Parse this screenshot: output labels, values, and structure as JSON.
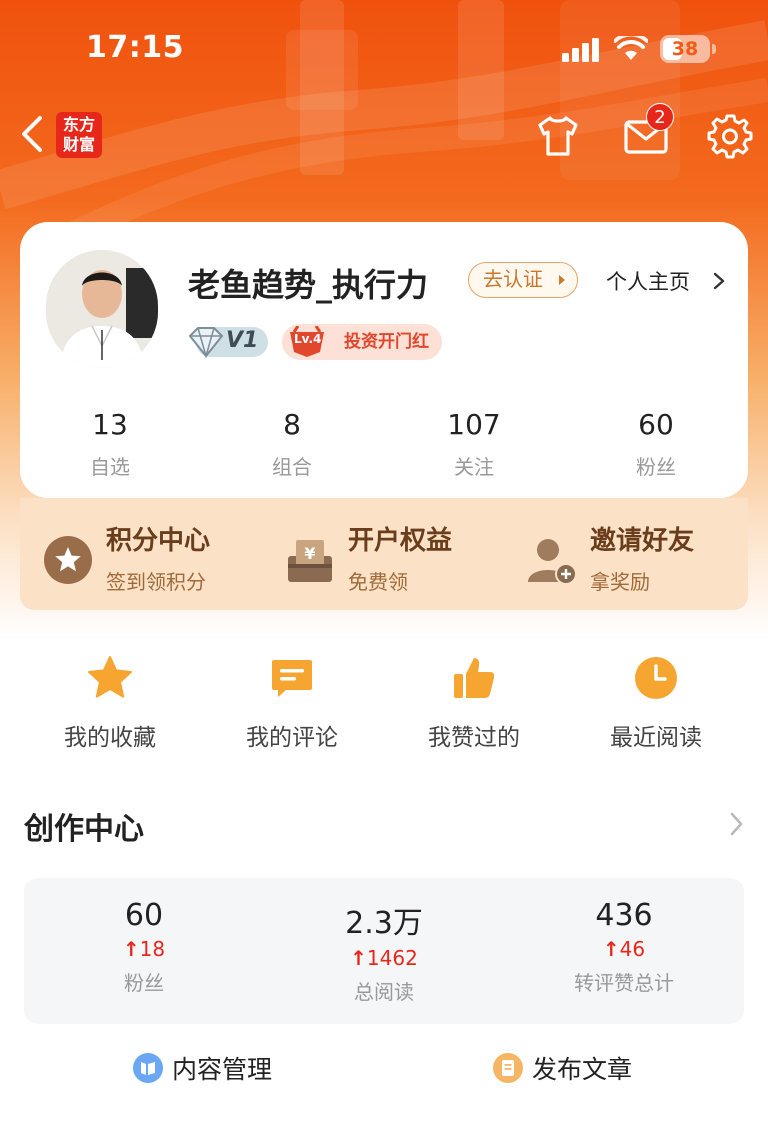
{
  "status_bar": {
    "time": "17:15",
    "battery_level": "38"
  },
  "header": {
    "logo_line1": "东方",
    "logo_line2": "财富",
    "mail_badge_count": "2",
    "icons": [
      "back-arrow-icon",
      "shirt-icon",
      "mail-icon",
      "gear-icon"
    ]
  },
  "profile": {
    "username": "老鱼趋势_执行力",
    "verify_label": "去认证",
    "homepage_label": "个人主页",
    "vip_label": "V1",
    "level_label": "Lv.4",
    "level_title": "投资开门红",
    "stats": [
      {
        "value": "13",
        "label": "自选"
      },
      {
        "value": "8",
        "label": "组合"
      },
      {
        "value": "107",
        "label": "关注"
      },
      {
        "value": "60",
        "label": "粉丝"
      }
    ]
  },
  "benefits": [
    {
      "title": "积分中心",
      "subtitle": "签到领积分",
      "icon": "star-coin-icon"
    },
    {
      "title": "开户权益",
      "subtitle": "免费领",
      "icon": "yen-box-icon"
    },
    {
      "title": "邀请好友",
      "subtitle": "拿奖励",
      "icon": "add-friend-icon"
    }
  ],
  "quick_actions": [
    {
      "label": "我的收藏",
      "icon": "star-icon"
    },
    {
      "label": "我的评论",
      "icon": "comment-icon"
    },
    {
      "label": "我赞过的",
      "icon": "thumbs-up-icon"
    },
    {
      "label": "最近阅读",
      "icon": "clock-icon"
    }
  ],
  "creator_center": {
    "title": "创作中心",
    "stats": [
      {
        "value": "60",
        "delta": "18",
        "label": "粉丝"
      },
      {
        "value": "2.3万",
        "delta": "1462",
        "label": "总阅读"
      },
      {
        "value": "436",
        "delta": "46",
        "label": "转评赞总计"
      }
    ],
    "actions": [
      {
        "label": "内容管理",
        "icon": "content-manage-icon"
      },
      {
        "label": "发布文章",
        "icon": "publish-article-icon"
      }
    ]
  },
  "colors": {
    "brand_orange": "#f0520e",
    "badge_red": "#e8271b",
    "delta_red": "#e8271b",
    "gold_text": "#6a3d1c"
  }
}
